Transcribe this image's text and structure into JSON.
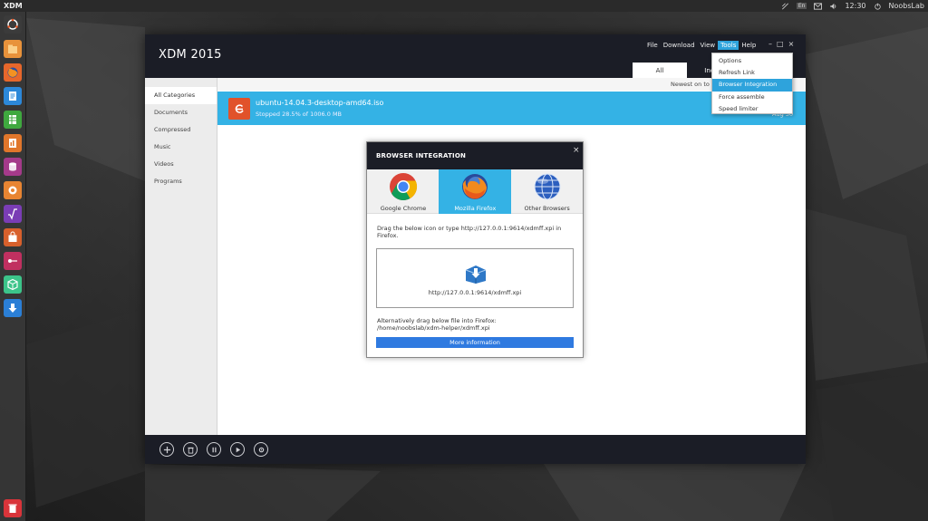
{
  "top_panel": {
    "app_name": "XDM",
    "time": "12:30",
    "user": "NoobsLab",
    "keyboard": "En"
  },
  "launcher": {
    "items": [
      {
        "name": "ubuntu-home-icon",
        "color": "#3b3b3b"
      },
      {
        "name": "files-icon",
        "color": "#e8923b"
      },
      {
        "name": "firefox-icon",
        "color": "#e7672b"
      },
      {
        "name": "writer-icon",
        "color": "#2c88d9"
      },
      {
        "name": "calc-icon",
        "color": "#3fa83f"
      },
      {
        "name": "impress-icon",
        "color": "#e0762b"
      },
      {
        "name": "base-icon",
        "color": "#a43a8a"
      },
      {
        "name": "blender-icon",
        "color": "#e88532"
      },
      {
        "name": "math-icon",
        "color": "#7a3db5"
      },
      {
        "name": "software-center-icon",
        "color": "#d8602c"
      },
      {
        "name": "settings-icon",
        "color": "#c03060"
      },
      {
        "name": "package-icon",
        "color": "#3cc48a"
      },
      {
        "name": "xdm-download-icon",
        "color": "#2b7fd6"
      },
      {
        "name": "trash-icon",
        "color": "#d9343a"
      }
    ]
  },
  "window": {
    "title": "XDM 2015",
    "menu": [
      "File",
      "Download",
      "View",
      "Tools",
      "Help"
    ],
    "tabs": [
      "All",
      "Incom"
    ],
    "sort_label": "Newest on to",
    "categories": [
      "All Categories",
      "Documents",
      "Compressed",
      "Music",
      "Videos",
      "Programs"
    ],
    "download": {
      "file_name": "ubuntu-14.04.3-desktop-amd64.iso",
      "status": "Stopped 28.5% of 1006.0 MB",
      "date": "Aug 30"
    }
  },
  "tools_menu": {
    "items": [
      "Options",
      "Refresh Link",
      "Browser Integration",
      "Force assemble",
      "Speed limiter"
    ]
  },
  "dialog": {
    "title": "BROWSER INTEGRATION",
    "close": "×",
    "browsers": [
      "Google Chrome",
      "Mozilla Firefox",
      "Other Browsers"
    ],
    "instruction": "Drag the below icon or type http://127.0.0.1:9614/xdmff.xpi in Firefox.",
    "drop_url": "http://127.0.0.1:9614/xdmff.xpi",
    "alt_text_line1": "Alternatively drag below file into Firefox:",
    "alt_text_line2": "/home/noobslab/xdm-helper/xdmff.xpi",
    "more_button": "More information"
  },
  "colors": {
    "accent": "#34b2e5",
    "header": "#1b1d26",
    "button_blue": "#2f7ae0"
  }
}
